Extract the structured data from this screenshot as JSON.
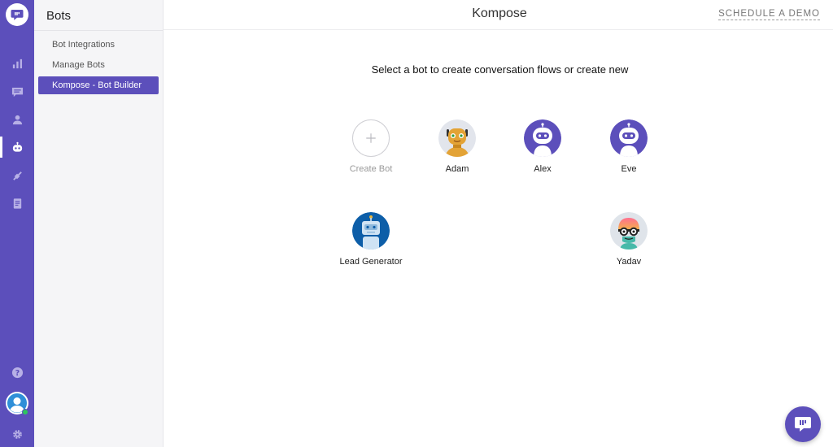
{
  "app": {
    "title": "Kompose",
    "schedule_demo": "SCHEDULE A DEMO",
    "accent_color": "#5c4fbb"
  },
  "rail": {
    "icons": [
      "chat-logo-icon",
      "bar-chart-icon",
      "conversations-icon",
      "users-icon",
      "bot-icon",
      "integrations-icon",
      "document-icon",
      "help-icon",
      "avatar-icon",
      "gear-icon"
    ],
    "active": "bot-icon"
  },
  "sidebar": {
    "title": "Bots",
    "items": [
      {
        "label": "Bot Integrations"
      },
      {
        "label": "Manage Bots"
      },
      {
        "label": "Kompose - Bot Builder",
        "active": true
      }
    ]
  },
  "main": {
    "prompt": "Select a bot to create conversation flows or create new",
    "create": {
      "label": "Create Bot"
    },
    "bots": [
      {
        "name": "Adam",
        "avatar": "robot-adam-icon"
      },
      {
        "name": "Alex",
        "avatar": "robot-purple-icon"
      },
      {
        "name": "Eve",
        "avatar": "robot-purple-icon"
      },
      {
        "name": "Lead Generator",
        "avatar": "robot-blue-icon"
      },
      {
        "name": "Yadav",
        "avatar": "robot-glasses-icon"
      }
    ]
  }
}
